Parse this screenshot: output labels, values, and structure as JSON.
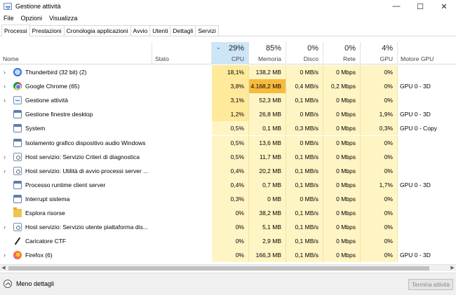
{
  "window": {
    "title": "Gestione attività"
  },
  "menu": [
    "File",
    "Opzioni",
    "Visualizza"
  ],
  "tabs": [
    {
      "label": "Processi",
      "active": true
    },
    {
      "label": "Prestazioni",
      "active": false
    },
    {
      "label": "Cronologia applicazioni",
      "active": false
    },
    {
      "label": "Avvio",
      "active": false
    },
    {
      "label": "Utenti",
      "active": false
    },
    {
      "label": "Dettagli",
      "active": false
    },
    {
      "label": "Servizi",
      "active": false
    }
  ],
  "columns": {
    "name": "Nome",
    "status": "Stato",
    "cpu": {
      "label": "CPU",
      "pct": "29%"
    },
    "memory": {
      "label": "Memoria",
      "pct": "85%"
    },
    "disk": {
      "label": "Disco",
      "pct": "0%"
    },
    "network": {
      "label": "Rete",
      "pct": "0%"
    },
    "gpu": {
      "label": "GPU",
      "pct": "4%"
    },
    "gpu_engine": "Motore GPU"
  },
  "rows": [
    {
      "name": "Thunderbird (32 bit) (2)",
      "icon": "thunderbird-icon",
      "expandable": true,
      "cpu": "18,1%",
      "mem": "138,2 MB",
      "disk": "0 MB/s",
      "net": "0 Mbps",
      "gpu": "0%",
      "engine": ""
    },
    {
      "name": "Google Chrome (65)",
      "icon": "chrome-icon",
      "expandable": true,
      "cpu": "3,8%",
      "mem": "4.168,2 MB",
      "disk": "0,4 MB/s",
      "net": "0,2 Mbps",
      "gpu": "0%",
      "engine": "GPU 0 - 3D"
    },
    {
      "name": "Gestione attività",
      "icon": "task-manager-icon",
      "expandable": true,
      "cpu": "3,1%",
      "mem": "52,3 MB",
      "disk": "0,1 MB/s",
      "net": "0 Mbps",
      "gpu": "0%",
      "engine": ""
    },
    {
      "name": "Gestione finestre desktop",
      "icon": "window-icon",
      "expandable": false,
      "cpu": "1,2%",
      "mem": "26,8 MB",
      "disk": "0 MB/s",
      "net": "0 Mbps",
      "gpu": "1,9%",
      "engine": "GPU 0 - 3D"
    },
    {
      "name": "System",
      "icon": "window-icon",
      "expandable": false,
      "cpu": "0,5%",
      "mem": "0,1 MB",
      "disk": "0,3 MB/s",
      "net": "0 Mbps",
      "gpu": "0,3%",
      "engine": "GPU 0 - Copy"
    },
    {
      "name": "Isolamento grafico dispositivo audio Windows",
      "icon": "window-icon",
      "expandable": false,
      "cpu": "0,5%",
      "mem": "13,6 MB",
      "disk": "0 MB/s",
      "net": "0 Mbps",
      "gpu": "0%",
      "engine": ""
    },
    {
      "name": "Host servizio: Servizio Criteri di diagnostica",
      "icon": "gear-icon",
      "expandable": true,
      "cpu": "0,5%",
      "mem": "11,7 MB",
      "disk": "0,1 MB/s",
      "net": "0 Mbps",
      "gpu": "0%",
      "engine": ""
    },
    {
      "name": "Host servizio: Utilità di avvio processi server ...",
      "icon": "gear-icon",
      "expandable": true,
      "cpu": "0,4%",
      "mem": "20,2 MB",
      "disk": "0,1 MB/s",
      "net": "0 Mbps",
      "gpu": "0%",
      "engine": ""
    },
    {
      "name": "Processo runtime client server",
      "icon": "window-icon",
      "expandable": false,
      "cpu": "0,4%",
      "mem": "0,7 MB",
      "disk": "0,1 MB/s",
      "net": "0 Mbps",
      "gpu": "1,7%",
      "engine": "GPU 0 - 3D"
    },
    {
      "name": "Interrupt sistema",
      "icon": "window-icon",
      "expandable": false,
      "cpu": "0,3%",
      "mem": "0 MB",
      "disk": "0 MB/s",
      "net": "0 Mbps",
      "gpu": "0%",
      "engine": ""
    },
    {
      "name": "Esplora risorse",
      "icon": "folder-icon",
      "expandable": false,
      "cpu": "0%",
      "mem": "38,2 MB",
      "disk": "0,1 MB/s",
      "net": "0 Mbps",
      "gpu": "0%",
      "engine": ""
    },
    {
      "name": "Host servizio: Servizio utente piattaforma dis...",
      "icon": "gear-icon",
      "expandable": true,
      "cpu": "0%",
      "mem": "5,1 MB",
      "disk": "0,1 MB/s",
      "net": "0 Mbps",
      "gpu": "0%",
      "engine": ""
    },
    {
      "name": "Caricatore CTF",
      "icon": "pen-icon",
      "expandable": false,
      "cpu": "0%",
      "mem": "2,9 MB",
      "disk": "0,1 MB/s",
      "net": "0 Mbps",
      "gpu": "0%",
      "engine": ""
    },
    {
      "name": "Firefox (6)",
      "icon": "firefox-icon",
      "expandable": true,
      "cpu": "0%",
      "mem": "166,3 MB",
      "disk": "0,1 MB/s",
      "net": "0 Mbps",
      "gpu": "0%",
      "engine": "GPU 0 - 3D"
    }
  ],
  "footer": {
    "fewer_details": "Meno dettagli",
    "end_task": "Termina attività"
  }
}
